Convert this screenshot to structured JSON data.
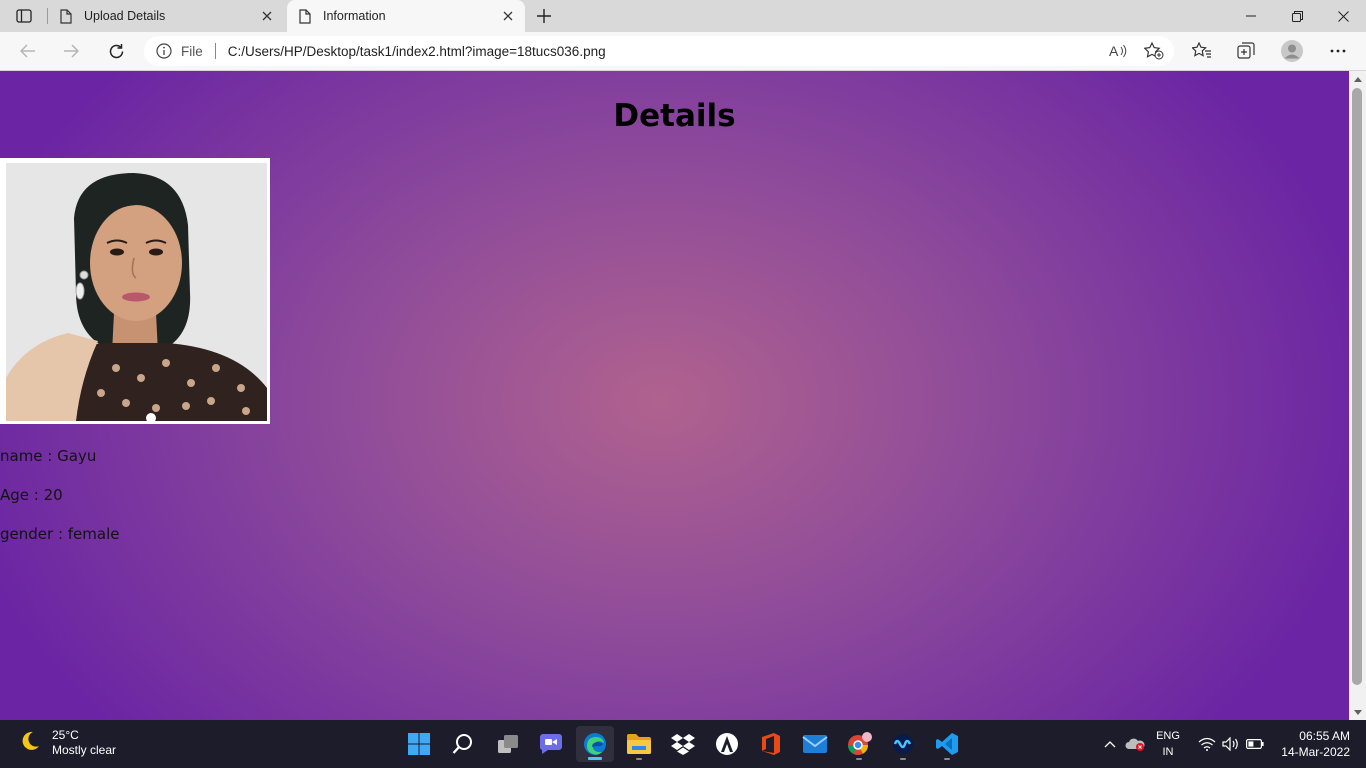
{
  "browser": {
    "tabs": [
      {
        "title": "Upload Details",
        "active": false
      },
      {
        "title": "Information",
        "active": true
      }
    ],
    "address": {
      "scheme_label": "File",
      "url": "C:/Users/HP/Desktop/task1/index2.html?image=18tucs036.png"
    }
  },
  "page": {
    "heading": "Details",
    "photo_alt": "profile-photo",
    "fields": [
      {
        "text": "name : Gayu"
      },
      {
        "text": "Age : 20"
      },
      {
        "text": "gender : female"
      }
    ]
  },
  "taskbar": {
    "weather": {
      "temp": "25°C",
      "condition": "Mostly clear"
    },
    "apps": [
      "start-icon",
      "search-icon",
      "task-view-icon",
      "chat-icon",
      "edge-icon",
      "file-explorer-icon",
      "dropbox-icon",
      "app-icon",
      "office-icon",
      "mail-icon",
      "chrome-icon",
      "app2-icon",
      "vscode-icon"
    ],
    "language": {
      "line1": "ENG",
      "line2": "IN"
    },
    "clock": {
      "time": "06:55 AM",
      "date": "14-Mar-2022"
    }
  },
  "colors": {
    "page_center": "#b0628e",
    "page_edge": "#6a24a4",
    "taskbar": "#1c1c2b",
    "edge_indicator": "#4cc2ff"
  }
}
